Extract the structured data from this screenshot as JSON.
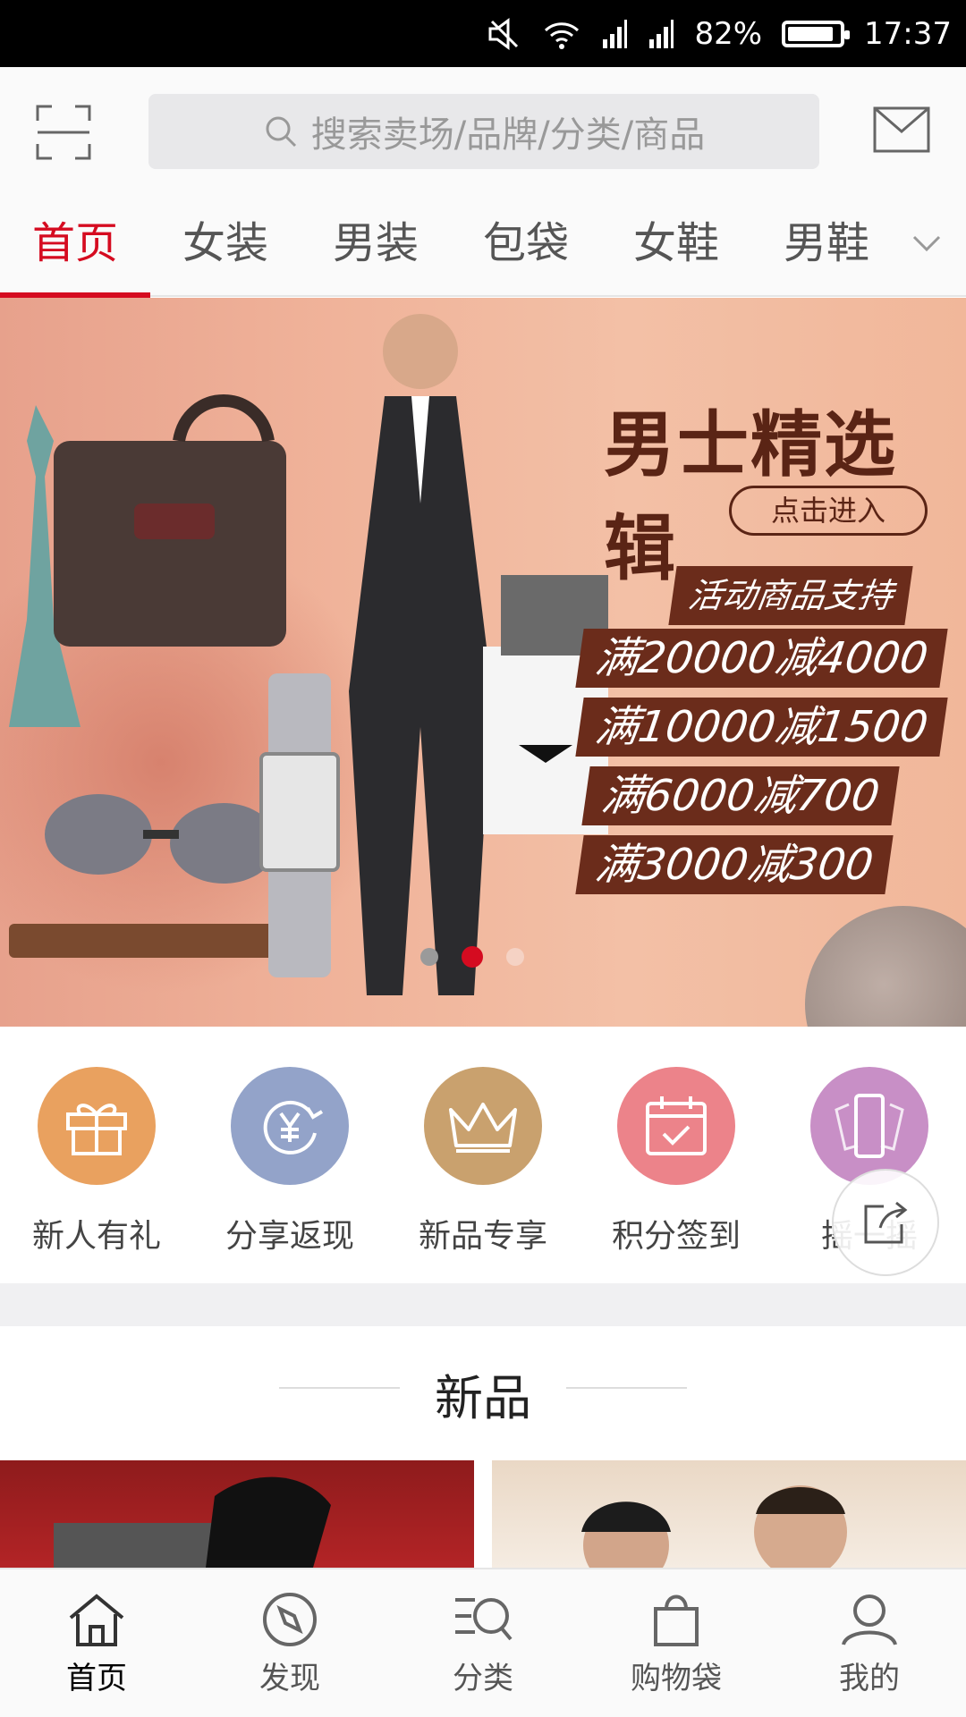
{
  "status_bar": {
    "battery": "82%",
    "time": "17:37",
    "icons": [
      "mute-icon",
      "wifi-icon",
      "signal-icon",
      "signal-icon-2",
      "battery-icon"
    ]
  },
  "header": {
    "search_placeholder": "搜索卖场/品牌/分类/商品",
    "icons": [
      "scan-icon",
      "search-icon",
      "mail-icon"
    ]
  },
  "tabs": [
    {
      "label": "首页",
      "active": true
    },
    {
      "label": "女装"
    },
    {
      "label": "男装"
    },
    {
      "label": "包袋"
    },
    {
      "label": "女鞋"
    },
    {
      "label": "男鞋"
    }
  ],
  "banner": {
    "title": "男士精选辑",
    "button": "点击进入",
    "lines": [
      "活动商品支持",
      "满20000减4000",
      "满10000减1500",
      "满6000减700",
      "满3000减300"
    ],
    "carousel": {
      "count": 3,
      "active_index": 1
    }
  },
  "shortcuts": [
    {
      "label": "新人有礼",
      "icon": "gift-icon",
      "color": "#e9a15f"
    },
    {
      "label": "分享返现",
      "icon": "yen-refresh-icon",
      "color": "#93a3c9"
    },
    {
      "label": "新品专享",
      "icon": "crown-icon",
      "color": "#c9a16e"
    },
    {
      "label": "积分签到",
      "icon": "calendar-check-icon",
      "color": "#ec838a"
    },
    {
      "label": "摇一摇",
      "icon": "phone-shake-icon",
      "color": "#c88fc6"
    }
  ],
  "section": {
    "title": "新品"
  },
  "bottom_nav": [
    {
      "label": "首页",
      "icon": "home-icon",
      "active": true
    },
    {
      "label": "发现",
      "icon": "compass-icon"
    },
    {
      "label": "分类",
      "icon": "category-search-icon"
    },
    {
      "label": "购物袋",
      "icon": "bag-icon"
    },
    {
      "label": "我的",
      "icon": "user-icon"
    }
  ]
}
